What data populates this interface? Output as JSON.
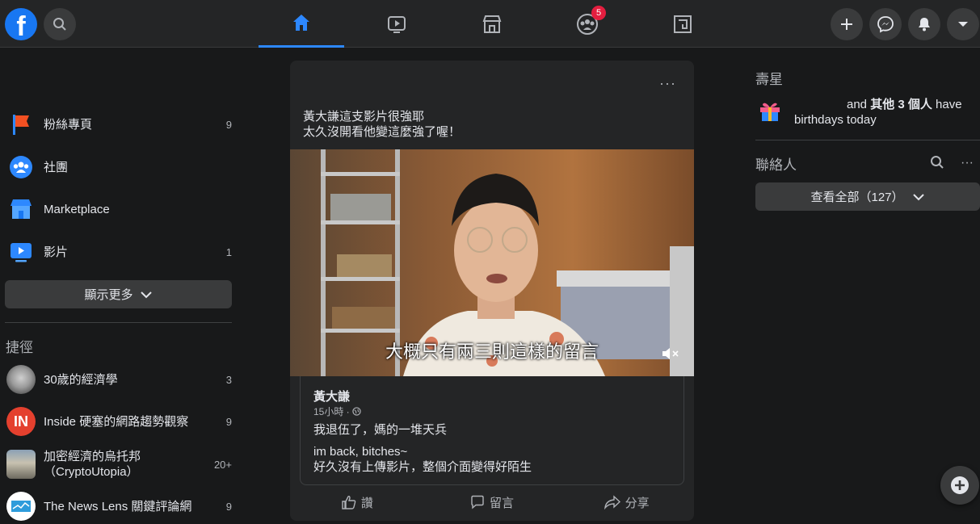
{
  "header": {
    "logo_letter": "f",
    "notification_badge": "5"
  },
  "sidebar": {
    "items": [
      {
        "label": "粉絲專頁",
        "count": "9"
      },
      {
        "label": "社團",
        "count": ""
      },
      {
        "label": "Marketplace",
        "count": ""
      },
      {
        "label": "影片",
        "count": "1"
      }
    ],
    "show_more_label": "顯示更多",
    "shortcuts_title": "捷徑",
    "shortcuts": [
      {
        "label": "30歲的經濟學",
        "count": "3"
      },
      {
        "label": "Inside 硬塞的網路趨勢觀察",
        "count": "9"
      },
      {
        "label": "加密經濟的烏托邦\n（CryptoUtopia）",
        "count": "20+"
      },
      {
        "label": "The News Lens 關鍵評論網",
        "count": "9"
      }
    ],
    "inside_avatar_text": "IN"
  },
  "post": {
    "more": "···",
    "text_line1": "黃大謙這支影片很強耶",
    "text_line2": "太久沒開看他變這麼強了喔！",
    "video_caption": "大概只有兩三則這樣的留言",
    "shared": {
      "author": "黃大謙",
      "time": "15小時 ·",
      "line1": "我退伍了，媽的一堆天兵",
      "line2": "im back, bitches~",
      "line3": "好久沒有上傳影片，整個介面變得好陌生"
    },
    "actions": {
      "like": "讚",
      "comment": "留言",
      "share": "分享"
    }
  },
  "right": {
    "birthdays_title": "壽星",
    "birthday_mid": "and ",
    "birthday_bold": "其他 3 個人",
    "birthday_end": " have",
    "birthday_line2": "birthdays today",
    "contacts_title": "聯絡人",
    "view_all_label": "查看全部（127）"
  },
  "colors": {
    "accent": "#2d88ff",
    "badge": "#e41e3f",
    "background": "#18191a",
    "surface": "#242526"
  }
}
